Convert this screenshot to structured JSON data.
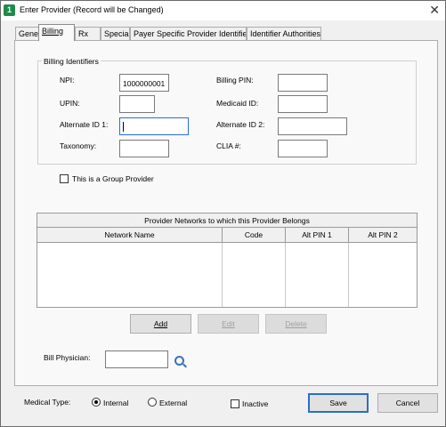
{
  "window": {
    "title": "Enter Provider  (Record will be Changed)"
  },
  "tabs": [
    {
      "label": "General"
    },
    {
      "label": "Billing"
    },
    {
      "label": "Rx"
    },
    {
      "label": "Special"
    },
    {
      "label": "Payer Specific Provider Identifiers"
    },
    {
      "label": "Identifier Authorities"
    }
  ],
  "billing_identifiers": {
    "title": "Billing Identifiers",
    "npi_label": "NPI:",
    "npi_value": "1000000001",
    "upin_label": "UPIN:",
    "upin_value": "",
    "alt_id1_label": "Alternate ID 1:",
    "alt_id1_value": "",
    "taxonomy_label": "Taxonomy:",
    "taxonomy_value": "",
    "billing_pin_label": "Billing PIN:",
    "billing_pin_value": "",
    "medicaid_label": "Medicaid ID:",
    "medicaid_value": "",
    "alt_id2_label": "Alternate ID 2:",
    "alt_id2_value": "",
    "clia_label": "CLIA #:",
    "clia_value": ""
  },
  "group_provider": {
    "label": "This is a Group Provider",
    "checked": false
  },
  "networks": {
    "caption": "Provider Networks to which this Provider Belongs",
    "columns": [
      "Network Name",
      "Code",
      "Alt PIN 1",
      "Alt PIN 2"
    ],
    "rows": []
  },
  "grid_buttons": {
    "add": "Add",
    "edit": "Edit",
    "delete": "Delete"
  },
  "bill_physician": {
    "label": "Bill Physician:",
    "value": ""
  },
  "medical_type": {
    "label": "Medical Type:",
    "internal": "Internal",
    "external": "External",
    "selected": "Internal"
  },
  "inactive": {
    "label": "Inactive",
    "checked": false
  },
  "footer": {
    "save": "Save",
    "cancel": "Cancel"
  },
  "icons": {
    "app": "app-icon",
    "close": "close-icon",
    "lookup": "magnifier-icon"
  }
}
